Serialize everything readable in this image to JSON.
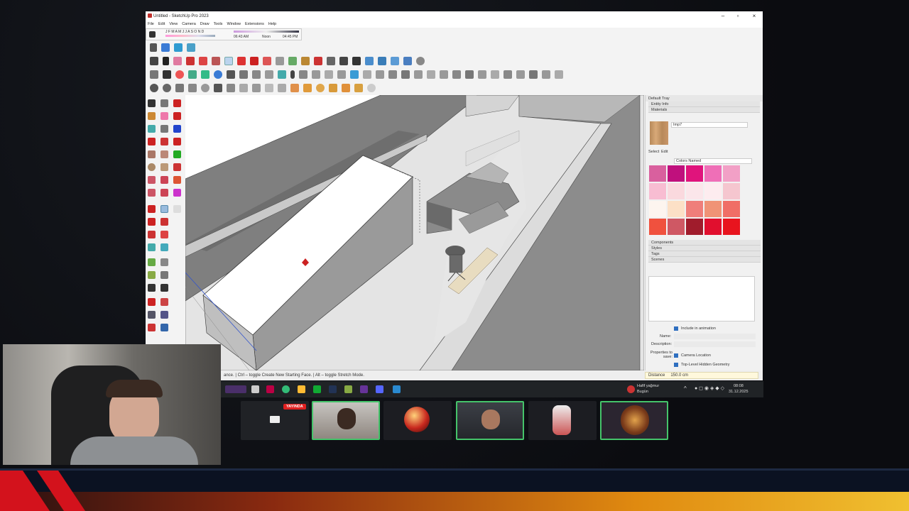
{
  "window": {
    "title": "Untitled - SketchUp Pro 2023",
    "menu": [
      "File",
      "Edit",
      "View",
      "Camera",
      "Draw",
      "Tools",
      "Window",
      "Extensions",
      "Help"
    ]
  },
  "shadow_settings": {
    "months": "J F M A M J J A S O N D",
    "time_start": "06:43 AM",
    "time_mid": "Noon",
    "time_end": "04:45 PM"
  },
  "status": {
    "hint": "ance. | Ctrl – toggle Create New Starting Face. | Alt – toggle Stretch Mode.",
    "distance_label": "Distance",
    "distance_value": "150.0 cm"
  },
  "tray": {
    "title": "Default Tray",
    "sections": [
      "Entity Info",
      "Materials"
    ],
    "material_name": "Imp7",
    "tabs": [
      "Select",
      "Edit"
    ],
    "library": "Colors Named",
    "lower_sections": [
      "Components",
      "Styles",
      "Tags",
      "Scenes"
    ],
    "scene_options": {
      "include_label": "Include in animation",
      "name_label": "Name:",
      "description_label": "Description:",
      "properties_label": "Properties to save:",
      "camera_label": "Camera Location",
      "hidden_label": "Top-Level Hidden Geometry"
    },
    "swatches": [
      "#d9609e",
      "#c0107d",
      "#e0147c",
      "#ef6fb7",
      "#f2a0c6",
      "#f8bdd2",
      "#fad9de",
      "#fbe6ea",
      "#fdecef",
      "#f5c6cf",
      "#fdf5ef",
      "#fce0c6",
      "#ef7e7a",
      "#f09376",
      "#f06e66",
      "#f0513e",
      "#cf5864",
      "#a01c2c",
      "#e10f2e",
      "#e8141e"
    ]
  },
  "taskbar": {
    "user": "Hafif yağmur",
    "user_sub": "Bugün",
    "time": "08:08",
    "date": "31.12.2025"
  },
  "stream": {
    "live_badge": "YAYINDA"
  }
}
